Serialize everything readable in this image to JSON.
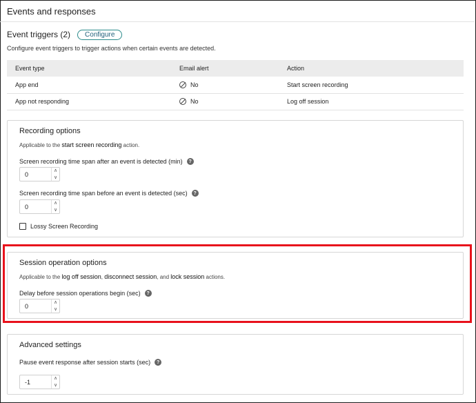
{
  "page": {
    "title": "Events and responses"
  },
  "triggers": {
    "title": "Event triggers (2)",
    "configure_label": "Configure",
    "description": "Configure event triggers to trigger actions when certain events are detected.",
    "columns": [
      "Event type",
      "Email alert",
      "Action"
    ],
    "rows": [
      {
        "event_type": "App end",
        "email_alert": "No",
        "action": "Start screen recording"
      },
      {
        "event_type": "App not responding",
        "email_alert": "No",
        "action": "Log off session"
      }
    ]
  },
  "recording": {
    "title": "Recording options",
    "desc_prefix": "Applicable to the ",
    "desc_bold": "start screen recording",
    "desc_suffix": " action.",
    "after_label": "Screen recording time span after an event is detected (min)",
    "after_value": "0",
    "before_label": "Screen recording time span before an event is detected (sec)",
    "before_value": "0",
    "lossy_label": "Lossy Screen Recording"
  },
  "session": {
    "title": "Session operation options",
    "desc_prefix": "Applicable to the ",
    "desc_b1": "log off session",
    "desc_sep1": ", ",
    "desc_b2": "disconnect session",
    "desc_sep2": ", and ",
    "desc_b3": "lock session",
    "desc_suffix": " actions.",
    "delay_label": "Delay before session operations begin (sec)",
    "delay_value": "0"
  },
  "advanced": {
    "title": "Advanced settings",
    "pause_label": "Pause event response after session starts (sec)",
    "pause_value": "-1"
  },
  "icons": {
    "help": "question-circle-icon",
    "no": "no-circle-icon",
    "up": "chevron-up-icon",
    "down": "chevron-down-icon"
  },
  "colors": {
    "highlight": "#e8111b",
    "configure_border": "#2a8a8a"
  }
}
